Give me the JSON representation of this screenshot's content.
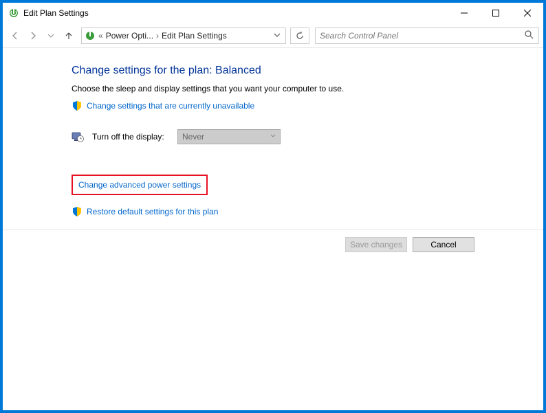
{
  "titlebar": {
    "title": "Edit Plan Settings"
  },
  "breadcrumb": {
    "ellipsis": "«",
    "crumb1": "Power Opti...",
    "crumb2": "Edit Plan Settings"
  },
  "search": {
    "placeholder": "Search Control Panel"
  },
  "main": {
    "heading": "Change settings for the plan: Balanced",
    "description": "Choose the sleep and display settings that you want your computer to use.",
    "unavailable_link": "Change settings that are currently unavailable",
    "display_label": "Turn off the display:",
    "display_value": "Never",
    "advanced_link": "Change advanced power settings",
    "restore_link": "Restore default settings for this plan"
  },
  "buttons": {
    "save": "Save changes",
    "cancel": "Cancel"
  }
}
